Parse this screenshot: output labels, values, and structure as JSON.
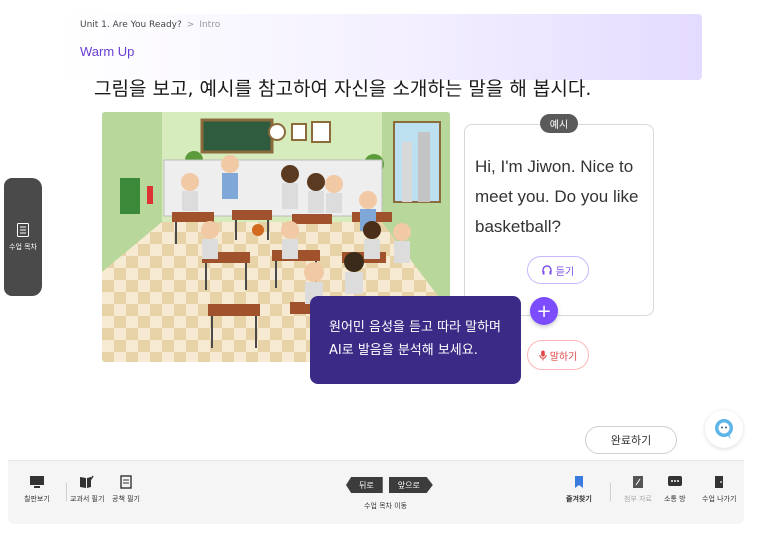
{
  "header": {
    "breadcrumb_unit": "Unit 1. Are You Ready?",
    "breadcrumb_sep": ">",
    "breadcrumb_page": "Intro",
    "section_title": "Warm Up",
    "instruction": "그림을 보고, 예시를 참고하여 자신을 소개하는 말을 해 봅시다."
  },
  "side_tab": {
    "label": "수업 목차",
    "icon": "list-icon"
  },
  "example": {
    "badge": "예시",
    "text": "Hi, I'm Jiwon. Nice to meet you. Do you like basketball?",
    "listen_label": "듣기",
    "speak_label": "말하기",
    "plus_symbol": "+"
  },
  "tooltip": {
    "line1": "원어민 음성을 듣고 따라 말하며",
    "line2": "AI로 발음을 분석해 보세요."
  },
  "complete_label": "완료하기",
  "bottom": {
    "board_label": "칠판보기",
    "textbook_note_label": "교과서 필기",
    "notebook_label": "공책 필기",
    "prev_label": "뒤로",
    "next_label": "앞으로",
    "nav_label": "수업 목차 이동",
    "bookmark_label": "즐겨찾기",
    "attach_label": "첨부 자료",
    "chat_label": "소통 방",
    "exit_label": "수업 나가기"
  },
  "colors": {
    "accent": "#7c4dff",
    "tooltip_bg": "#3b2a86",
    "section_title": "#6a3fd8",
    "speak": "#e04646"
  }
}
